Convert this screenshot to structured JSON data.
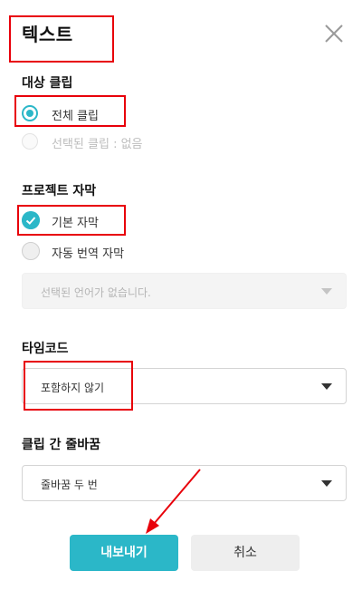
{
  "dialog": {
    "title": "텍스트",
    "close_icon": "close-icon"
  },
  "clip_target": {
    "label": "대상 클립",
    "options": [
      {
        "label": "전체 클립",
        "selected": true
      },
      {
        "label": "선택된 클립 : 없음",
        "selected": false,
        "disabled": true
      }
    ]
  },
  "project_subtitles": {
    "label": "프로젝트 자막",
    "options": [
      {
        "label": "기본 자막",
        "checked": true
      },
      {
        "label": "자동 번역 자막",
        "checked": false
      }
    ],
    "language_select": {
      "value": "선택된 언어가 없습니다.",
      "disabled": true
    }
  },
  "timecode": {
    "label": "타임코드",
    "value": "포함하지 않기"
  },
  "line_break": {
    "label": "클립 간 줄바꿈",
    "value": "줄바꿈 두 번"
  },
  "buttons": {
    "export": "내보내기",
    "cancel": "취소"
  },
  "colors": {
    "accent": "#2bb7c8",
    "annotation": "#e8000a"
  }
}
